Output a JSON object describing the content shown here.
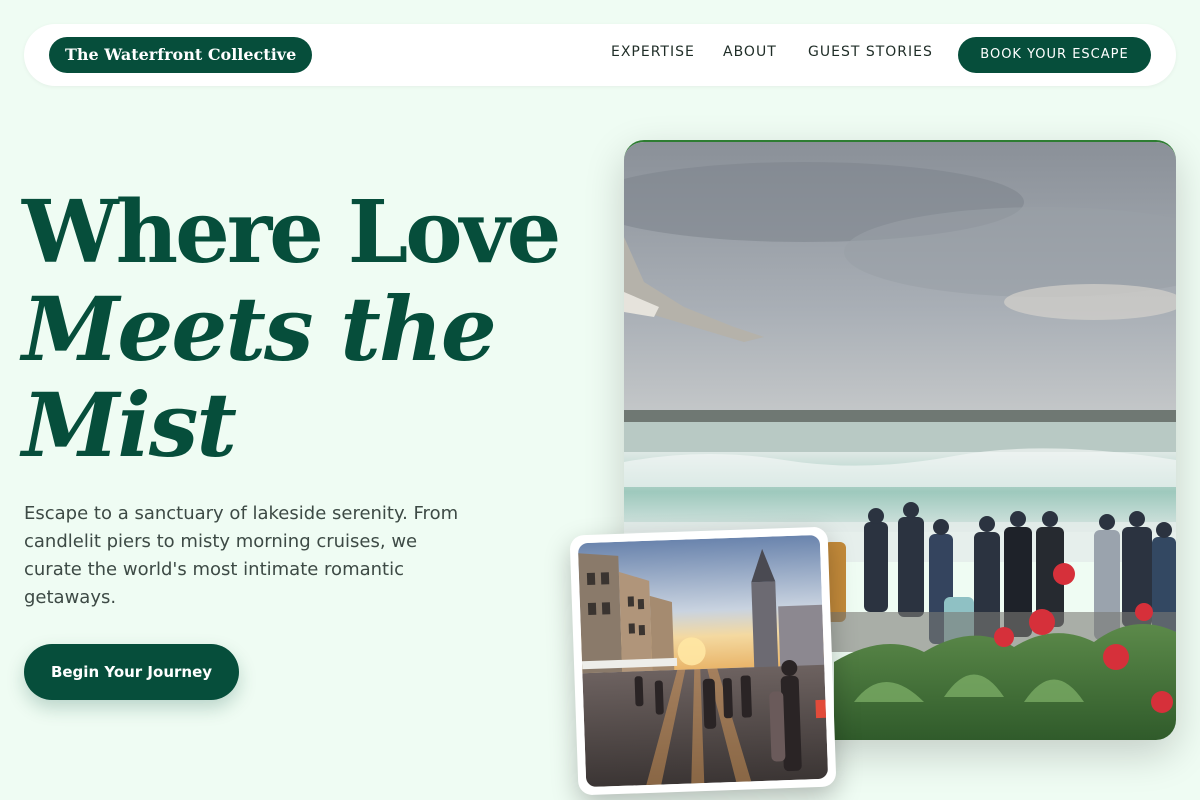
{
  "brand": {
    "name": "The Waterfront Collective"
  },
  "nav": {
    "links": [
      "EXPERTISE",
      "ABOUT",
      "GUEST STORIES"
    ],
    "cta": "BOOK YOUR ESCAPE"
  },
  "hero": {
    "line1": "Where Love",
    "line2": "Meets the",
    "line3": "Mist",
    "description": "Escape to a sanctuary of lakeside serenity. From candlelit piers to misty morning cruises, we curate the world's most intimate romantic getaways.",
    "button": "Begin Your Journey"
  },
  "colors": {
    "background": "#effcf3",
    "primary": "#064e3b",
    "text": "#3d4a45"
  }
}
